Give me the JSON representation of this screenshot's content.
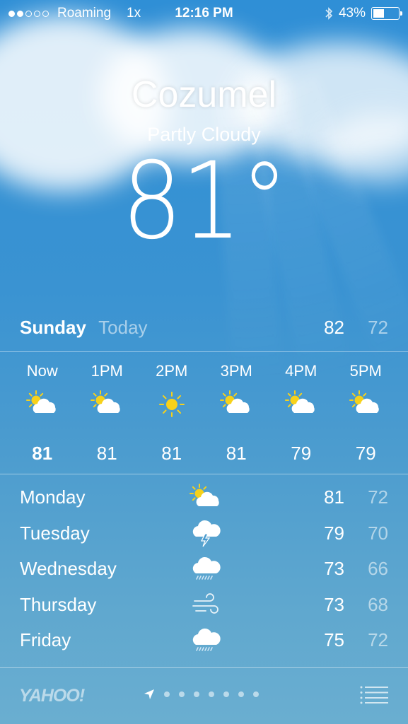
{
  "status": {
    "carrier": "Roaming",
    "network": "1x",
    "time": "12:16 PM",
    "battery": "43%",
    "battery_level": 0.43,
    "signal_bars": 2,
    "signal_total": 5
  },
  "location": {
    "city": "Cozumel",
    "condition": "Partly Cloudy",
    "temperature": "81°"
  },
  "today": {
    "day": "Sunday",
    "label": "Today",
    "high": "82",
    "low": "72"
  },
  "hourly": [
    {
      "time": "Now",
      "icon": "partly-cloudy-icon",
      "temp": "81"
    },
    {
      "time": "1PM",
      "icon": "partly-cloudy-icon",
      "temp": "81"
    },
    {
      "time": "2PM",
      "icon": "sunny-icon",
      "temp": "81"
    },
    {
      "time": "3PM",
      "icon": "partly-cloudy-icon",
      "temp": "81"
    },
    {
      "time": "4PM",
      "icon": "partly-cloudy-icon",
      "temp": "79"
    },
    {
      "time": "5PM",
      "icon": "partly-cloudy-icon",
      "temp": "79"
    }
  ],
  "daily": [
    {
      "day": "Monday",
      "icon": "partly-cloudy-icon",
      "high": "81",
      "low": "72"
    },
    {
      "day": "Tuesday",
      "icon": "thunderstorm-icon",
      "high": "79",
      "low": "70"
    },
    {
      "day": "Wednesday",
      "icon": "rain-icon",
      "high": "73",
      "low": "66"
    },
    {
      "day": "Thursday",
      "icon": "wind-icon",
      "high": "73",
      "low": "68"
    },
    {
      "day": "Friday",
      "icon": "rain-icon",
      "high": "75",
      "low": "72"
    }
  ],
  "footer": {
    "brand": "YAHOO!",
    "page_count": 7,
    "current_page": 0
  },
  "colors": {
    "sun": "#f7d11a",
    "cloud": "#ffffff",
    "sky_top": "#2f8fd6",
    "sky_bottom": "#6aaed0"
  }
}
